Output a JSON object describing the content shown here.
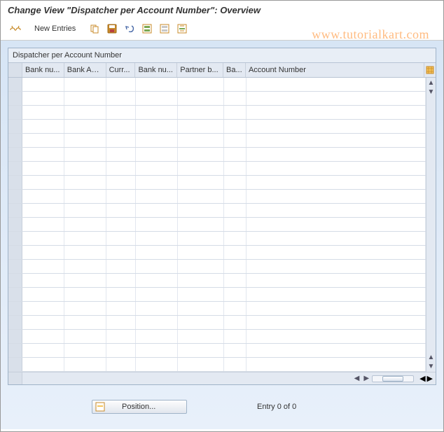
{
  "header": {
    "title": "Change View \"Dispatcher per Account Number\": Overview"
  },
  "toolbar": {
    "new_entries_label": "New Entries"
  },
  "watermark": "www.tutorialkart.com",
  "grid": {
    "title": "Dispatcher per Account Number",
    "columns": [
      "Bank nu...",
      "Bank Acc...",
      "Curr...",
      "Bank nu...",
      "Partner b...",
      "Ba...",
      "Account Number"
    ],
    "rows": 21
  },
  "footer": {
    "position_label": "Position...",
    "entry_label": "Entry 0 of 0"
  }
}
